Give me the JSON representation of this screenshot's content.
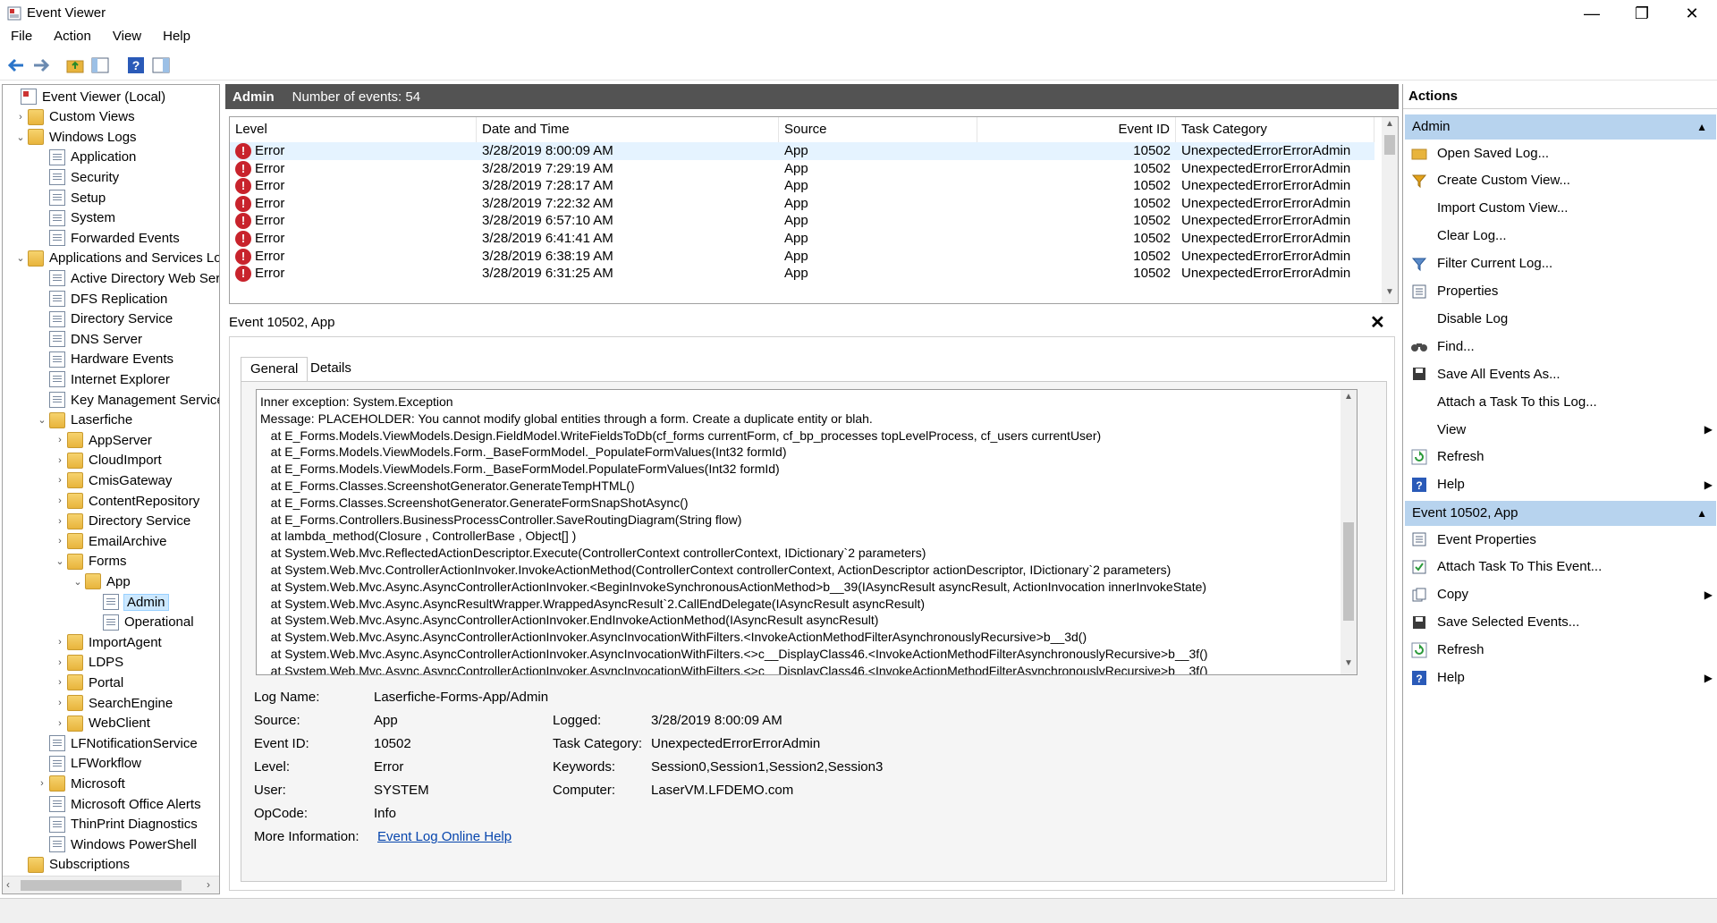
{
  "window": {
    "title": "Event Viewer",
    "minimize": "—",
    "maximize": "❐",
    "close": "✕"
  },
  "menu": [
    "File",
    "Action",
    "View",
    "Help"
  ],
  "tree": [
    {
      "label": "Event Viewer (Local)",
      "level": 0,
      "icon": "root",
      "chev": ""
    },
    {
      "label": "Custom Views",
      "level": 1,
      "icon": "folder",
      "chev": "›"
    },
    {
      "label": "Windows Logs",
      "level": 1,
      "icon": "folder",
      "chev": "⌄"
    },
    {
      "label": "Application",
      "level": 2,
      "icon": "log",
      "chev": ""
    },
    {
      "label": "Security",
      "level": 2,
      "icon": "log",
      "chev": ""
    },
    {
      "label": "Setup",
      "level": 2,
      "icon": "log",
      "chev": ""
    },
    {
      "label": "System",
      "level": 2,
      "icon": "log",
      "chev": ""
    },
    {
      "label": "Forwarded Events",
      "level": 2,
      "icon": "log",
      "chev": ""
    },
    {
      "label": "Applications and Services Lo",
      "level": 1,
      "icon": "folder",
      "chev": "⌄"
    },
    {
      "label": "Active Directory Web Ser",
      "level": 2,
      "icon": "log",
      "chev": ""
    },
    {
      "label": "DFS Replication",
      "level": 2,
      "icon": "log",
      "chev": ""
    },
    {
      "label": "Directory Service",
      "level": 2,
      "icon": "log",
      "chev": ""
    },
    {
      "label": "DNS Server",
      "level": 2,
      "icon": "log",
      "chev": ""
    },
    {
      "label": "Hardware Events",
      "level": 2,
      "icon": "log",
      "chev": ""
    },
    {
      "label": "Internet Explorer",
      "level": 2,
      "icon": "log",
      "chev": ""
    },
    {
      "label": "Key Management Service",
      "level": 2,
      "icon": "log",
      "chev": ""
    },
    {
      "label": "Laserfiche",
      "level": 2,
      "icon": "folder",
      "chev": "⌄"
    },
    {
      "label": "AppServer",
      "level": 3,
      "icon": "folder",
      "chev": "›"
    },
    {
      "label": "CloudImport",
      "level": 3,
      "icon": "folder",
      "chev": "›"
    },
    {
      "label": "CmisGateway",
      "level": 3,
      "icon": "folder",
      "chev": "›"
    },
    {
      "label": "ContentRepository",
      "level": 3,
      "icon": "folder",
      "chev": "›"
    },
    {
      "label": "Directory Service",
      "level": 3,
      "icon": "folder",
      "chev": "›"
    },
    {
      "label": "EmailArchive",
      "level": 3,
      "icon": "folder",
      "chev": "›"
    },
    {
      "label": "Forms",
      "level": 3,
      "icon": "folder",
      "chev": "⌄"
    },
    {
      "label": "App",
      "level": 4,
      "icon": "folder",
      "chev": "⌄"
    },
    {
      "label": "Admin",
      "level": 5,
      "icon": "log",
      "chev": "",
      "selected": true
    },
    {
      "label": "Operational",
      "level": 5,
      "icon": "log",
      "chev": ""
    },
    {
      "label": "ImportAgent",
      "level": 3,
      "icon": "folder",
      "chev": "›"
    },
    {
      "label": "LDPS",
      "level": 3,
      "icon": "folder",
      "chev": "›"
    },
    {
      "label": "Portal",
      "level": 3,
      "icon": "folder",
      "chev": "›"
    },
    {
      "label": "SearchEngine",
      "level": 3,
      "icon": "folder",
      "chev": "›"
    },
    {
      "label": "WebClient",
      "level": 3,
      "icon": "folder",
      "chev": "›"
    },
    {
      "label": "LFNotificationService",
      "level": 2,
      "icon": "log",
      "chev": ""
    },
    {
      "label": "LFWorkflow",
      "level": 2,
      "icon": "log",
      "chev": ""
    },
    {
      "label": "Microsoft",
      "level": 2,
      "icon": "folder",
      "chev": "›"
    },
    {
      "label": "Microsoft Office Alerts",
      "level": 2,
      "icon": "log",
      "chev": ""
    },
    {
      "label": "ThinPrint Diagnostics",
      "level": 2,
      "icon": "log",
      "chev": ""
    },
    {
      "label": "Windows PowerShell",
      "level": 2,
      "icon": "log",
      "chev": ""
    },
    {
      "label": "Subscriptions",
      "level": 1,
      "icon": "folder",
      "chev": ""
    }
  ],
  "events_header": {
    "log": "Admin",
    "count_text": "Number of events: 54"
  },
  "columns": [
    "Level",
    "Date and Time",
    "Source",
    "Event ID",
    "Task Category"
  ],
  "events": [
    {
      "level": "Error",
      "date": "3/28/2019 8:00:09 AM",
      "source": "App",
      "id": "10502",
      "category": "UnexpectedErrorErrorAdmin"
    },
    {
      "level": "Error",
      "date": "3/28/2019 7:29:19 AM",
      "source": "App",
      "id": "10502",
      "category": "UnexpectedErrorErrorAdmin"
    },
    {
      "level": "Error",
      "date": "3/28/2019 7:28:17 AM",
      "source": "App",
      "id": "10502",
      "category": "UnexpectedErrorErrorAdmin"
    },
    {
      "level": "Error",
      "date": "3/28/2019 7:22:32 AM",
      "source": "App",
      "id": "10502",
      "category": "UnexpectedErrorErrorAdmin"
    },
    {
      "level": "Error",
      "date": "3/28/2019 6:57:10 AM",
      "source": "App",
      "id": "10502",
      "category": "UnexpectedErrorErrorAdmin"
    },
    {
      "level": "Error",
      "date": "3/28/2019 6:41:41 AM",
      "source": "App",
      "id": "10502",
      "category": "UnexpectedErrorErrorAdmin"
    },
    {
      "level": "Error",
      "date": "3/28/2019 6:38:19 AM",
      "source": "App",
      "id": "10502",
      "category": "UnexpectedErrorErrorAdmin"
    },
    {
      "level": "Error",
      "date": "3/28/2019 6:31:25 AM",
      "source": "App",
      "id": "10502",
      "category": "UnexpectedErrorErrorAdmin"
    }
  ],
  "detail": {
    "title": "Event 10502, App",
    "close": "✕",
    "tabs": [
      "General",
      "Details"
    ],
    "message_lines": [
      "Inner exception: System.Exception",
      "Message: PLACEHOLDER: You cannot modify global entities through a form. Create a duplicate entity or blah.",
      "   at E_Forms.Models.ViewModels.Design.FieldModel.WriteFieldsToDb(cf_forms currentForm, cf_bp_processes topLevelProcess, cf_users currentUser)",
      "   at E_Forms.Models.ViewModels.Form._BaseFormModel._PopulateFormValues(Int32 formId)",
      "   at E_Forms.Models.ViewModels.Form._BaseFormModel.PopulateFormValues(Int32 formId)",
      "   at E_Forms.Classes.ScreenshotGenerator.GenerateTempHTML()",
      "   at E_Forms.Classes.ScreenshotGenerator.GenerateFormSnapShotAsync()",
      "   at E_Forms.Controllers.BusinessProcessController.SaveRoutingDiagram(String flow)",
      "   at lambda_method(Closure , ControllerBase , Object[] )",
      "   at System.Web.Mvc.ReflectedActionDescriptor.Execute(ControllerContext controllerContext, IDictionary`2 parameters)",
      "   at System.Web.Mvc.ControllerActionInvoker.InvokeActionMethod(ControllerContext controllerContext, ActionDescriptor actionDescriptor, IDictionary`2 parameters)",
      "   at System.Web.Mvc.Async.AsyncControllerActionInvoker.<BeginInvokeSynchronousActionMethod>b__39(IAsyncResult asyncResult, ActionInvocation innerInvokeState)",
      "   at System.Web.Mvc.Async.AsyncResultWrapper.WrappedAsyncResult`2.CallEndDelegate(IAsyncResult asyncResult)",
      "   at System.Web.Mvc.Async.AsyncControllerActionInvoker.EndInvokeActionMethod(IAsyncResult asyncResult)",
      "   at System.Web.Mvc.Async.AsyncControllerActionInvoker.AsyncInvocationWithFilters.<InvokeActionMethodFilterAsynchronouslyRecursive>b__3d()",
      "   at System.Web.Mvc.Async.AsyncControllerActionInvoker.AsyncInvocationWithFilters.<>c__DisplayClass46.<InvokeActionMethodFilterAsynchronouslyRecursive>b__3f()",
      "   at System.Web.Mvc.Async.AsyncControllerActionInvoker.AsyncInvocationWithFilters.<>c__DisplayClass46.<InvokeActionMethodFilterAsynchronouslyRecursive>b__3f()"
    ],
    "fields": {
      "log_name_label": "Log Name:",
      "log_name": "Laserfiche-Forms-App/Admin",
      "source_label": "Source:",
      "source": "App",
      "logged_label": "Logged:",
      "logged": "3/28/2019 8:00:09 AM",
      "event_id_label": "Event ID:",
      "event_id": "10502",
      "task_category_label": "Task Category:",
      "task_category": "UnexpectedErrorErrorAdmin",
      "level_label": "Level:",
      "level": "Error",
      "keywords_label": "Keywords:",
      "keywords": "Session0,Session1,Session2,Session3",
      "user_label": "User:",
      "user": "SYSTEM",
      "computer_label": "Computer:",
      "computer": "LaserVM.LFDEMO.com",
      "opcode_label": "OpCode:",
      "opcode": "Info",
      "more_info_label": "More Information:",
      "more_info_link": "Event Log Online Help"
    }
  },
  "actions": {
    "title": "Actions",
    "section1": "Admin",
    "items1": [
      {
        "label": "Open Saved Log...",
        "icon": "folder-open-icon",
        "sub": false
      },
      {
        "label": "Create Custom View...",
        "icon": "funnel-icon",
        "sub": false
      },
      {
        "label": "Import Custom View...",
        "icon": "",
        "sub": false
      },
      {
        "label": "Clear Log...",
        "icon": "",
        "sub": false
      },
      {
        "label": "Filter Current Log...",
        "icon": "filter-icon",
        "sub": false
      },
      {
        "label": "Properties",
        "icon": "properties-icon",
        "sub": false
      },
      {
        "label": "Disable Log",
        "icon": "",
        "sub": false
      },
      {
        "label": "Find...",
        "icon": "binoculars-icon",
        "sub": false
      },
      {
        "label": "Save All Events As...",
        "icon": "save-icon",
        "sub": false
      },
      {
        "label": "Attach a Task To this Log...",
        "icon": "",
        "sub": false
      },
      {
        "label": "View",
        "icon": "",
        "sub": true
      },
      {
        "label": "Refresh",
        "icon": "refresh-icon",
        "sub": false
      },
      {
        "label": "Help",
        "icon": "help-icon",
        "sub": true
      }
    ],
    "section2": "Event 10502, App",
    "items2": [
      {
        "label": "Event Properties",
        "icon": "properties-icon",
        "sub": false
      },
      {
        "label": "Attach Task To This Event...",
        "icon": "task-icon",
        "sub": false
      },
      {
        "label": "Copy",
        "icon": "copy-icon",
        "sub": true
      },
      {
        "label": "Save Selected Events...",
        "icon": "save-icon",
        "sub": false
      },
      {
        "label": "Refresh",
        "icon": "refresh-icon",
        "sub": false
      },
      {
        "label": "Help",
        "icon": "help-icon",
        "sub": true
      }
    ]
  },
  "colors": {
    "section_bg": "#b7d3ee",
    "header_bg": "#535353",
    "error": "#c8232c",
    "link": "#0645ad"
  }
}
